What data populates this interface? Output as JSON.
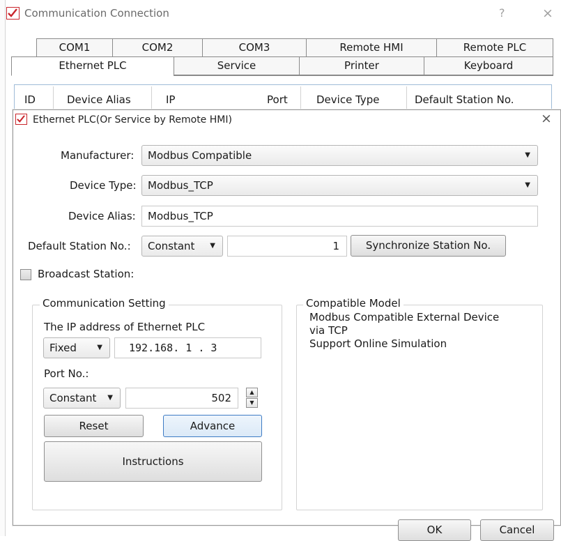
{
  "window": {
    "title": "Communication Connection",
    "help_glyph": "?",
    "close_glyph": "×"
  },
  "tabs_row1": [
    "COM1",
    "COM2",
    "COM3",
    "Remote HMI",
    "Remote PLC"
  ],
  "tabs_row2": [
    "Ethernet PLC",
    "Service",
    "Printer",
    "Keyboard"
  ],
  "active_tab": "Ethernet PLC",
  "list": {
    "columns": [
      "ID",
      "Device Alias",
      "IP",
      "Port",
      "Device Type",
      "Default Station No."
    ]
  },
  "dialog": {
    "title": "Ethernet PLC(Or Service by Remote HMI)",
    "close_glyph": "×",
    "manufacturer": {
      "label": "Manufacturer:",
      "value": "Modbus Compatible"
    },
    "device_type": {
      "label": "Device Type:",
      "value": "Modbus_TCP"
    },
    "device_alias": {
      "label": "Device Alias:",
      "value": "Modbus_TCP"
    },
    "default_station": {
      "label": "Default Station No.:",
      "mode": "Constant",
      "value": "1",
      "sync_button": "Synchronize Station No."
    },
    "broadcast": {
      "label": "Broadcast Station:",
      "checked": false
    },
    "comm_setting": {
      "legend": "Communication Setting",
      "ip_label": "The IP address of Ethernet PLC",
      "ip_mode": "Fixed",
      "ip_value": "192.168. 1 . 3",
      "port_label": "Port No.:",
      "port_mode": "Constant",
      "port_value": "502",
      "reset_button": "Reset",
      "advance_button": "Advance",
      "instructions_button": "Instructions"
    },
    "compatible_model": {
      "legend": "Compatible Model",
      "text": "Modbus Compatible External Device\nvia TCP\nSupport Online Simulation"
    },
    "ok_button": "OK",
    "cancel_button": "Cancel"
  },
  "colors": {
    "accent_blue": "#3d7bc4",
    "icon_red": "#c9252b",
    "list_border": "#9ebbd8"
  },
  "icons": {
    "app": "red-check-icon",
    "dropdown": "chevron-down-icon",
    "spin_up": "triangle-up-icon",
    "spin_down": "triangle-down-icon"
  }
}
